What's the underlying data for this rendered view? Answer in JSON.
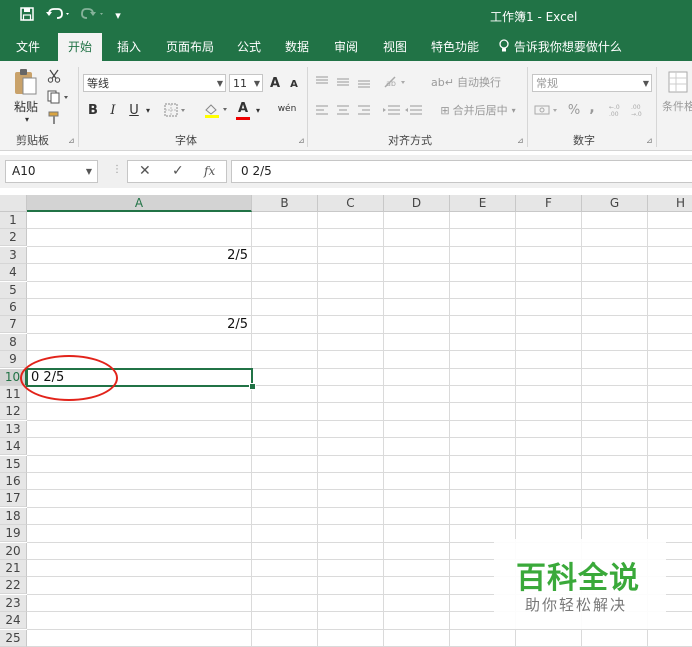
{
  "window": {
    "title": "工作簿1 - Excel"
  },
  "quick_access": {
    "icons": [
      "save-icon",
      "undo-icon",
      "redo-icon",
      "customize-icon"
    ]
  },
  "tabs": [
    {
      "label": "文件",
      "active": false
    },
    {
      "label": "开始",
      "active": true
    },
    {
      "label": "插入",
      "active": false
    },
    {
      "label": "页面布局",
      "active": false
    },
    {
      "label": "公式",
      "active": false
    },
    {
      "label": "数据",
      "active": false
    },
    {
      "label": "审阅",
      "active": false
    },
    {
      "label": "视图",
      "active": false
    },
    {
      "label": "特色功能",
      "active": false
    }
  ],
  "tell_me": "告诉我你想要做什么",
  "ribbon": {
    "clipboard": {
      "label": "剪贴板",
      "paste": "粘贴"
    },
    "font": {
      "label": "字体",
      "name": "等线",
      "size": "11",
      "bold": "B",
      "italic": "I",
      "underline": "U",
      "grow": "A",
      "shrink": "A",
      "font_color": "A",
      "phonetic": "wén"
    },
    "alignment": {
      "label": "对齐方式",
      "wrap_text": "自动换行",
      "merge_center": "合并后居中"
    },
    "number": {
      "label": "数字",
      "format": "常规",
      "percent": "%",
      "comma": ","
    },
    "styles": {
      "label": "条件格"
    }
  },
  "formula_bar": {
    "name_box": "A10",
    "cancel": "✕",
    "enter": "✓",
    "fx": "fx",
    "formula": "0 2/5"
  },
  "columns": [
    "A",
    "B",
    "C",
    "D",
    "E",
    "F",
    "G",
    "H"
  ],
  "rows": [
    "1",
    "2",
    "3",
    "4",
    "5",
    "6",
    "7",
    "8",
    "9",
    "10",
    "11",
    "12",
    "13",
    "14",
    "15",
    "16",
    "17",
    "18",
    "19",
    "20",
    "21",
    "22",
    "23",
    "24",
    "25"
  ],
  "cells": [
    {
      "ref": "A3",
      "value": "2/5"
    },
    {
      "ref": "A7",
      "value": "2/5"
    },
    {
      "ref": "A10",
      "value": "0 2/5"
    }
  ],
  "active_cell": "A10",
  "highlight_color": "#e2231a",
  "accent_color": "#217346",
  "watermark": {
    "title": "百科全说",
    "subtitle": "助你轻松解决"
  }
}
